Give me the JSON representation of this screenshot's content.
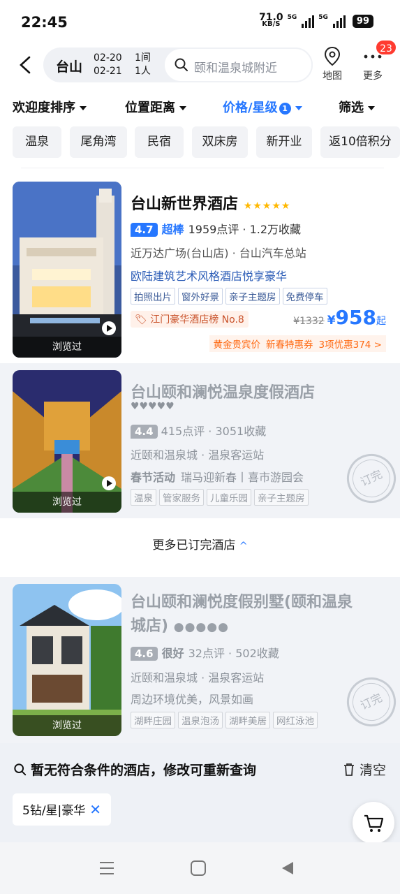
{
  "status": {
    "time": "22:45",
    "speed": "71.0",
    "speed_unit": "KB/S",
    "net1": "5G",
    "net2": "5G",
    "battery": "99"
  },
  "header": {
    "city": "台山",
    "date_in": "02-20",
    "date_out": "02-21",
    "rooms": "1间",
    "people": "1人",
    "search_placeholder": "颐和温泉城附近",
    "map_label": "地图",
    "more_label": "更多",
    "more_badge": "23"
  },
  "sort_bar": [
    {
      "label": "欢迎度排序",
      "active": false
    },
    {
      "label": "位置距离",
      "active": false
    },
    {
      "label": "价格/星级",
      "active": true,
      "count": "1"
    },
    {
      "label": "筛选",
      "active": false
    }
  ],
  "quick_filters": [
    "温泉",
    "尾角湾",
    "民宿",
    "双床房",
    "新开业",
    "返10倍积分"
  ],
  "hotels": [
    {
      "name": "台山新世界酒店",
      "stars": "★★★★★",
      "score": "4.7",
      "score_word": "超棒",
      "reviews": "1959点评 · 1.2万收藏",
      "location": "近万达广场(台山店) · 台山汽车总站",
      "feature": "欧陆建筑艺术风格酒店悦享豪华",
      "tags": [
        "拍照出片",
        "窗外好景",
        "亲子主题房",
        "免费停车"
      ],
      "rank": "江门豪华酒店榜 No.8",
      "old_price": "¥1332",
      "currency": "¥",
      "price": "958",
      "price_suffix": "起",
      "promos": [
        "黄金贵宾价",
        "新春特惠券",
        "3项优惠374 >"
      ],
      "viewed_label": "浏览过"
    },
    {
      "name": "台山颐和澜悦温泉度假酒店",
      "stars": "♥♥♥♥♥",
      "score": "4.4",
      "reviews": "415点评 · 3051收藏",
      "location": "近颐和温泉城 · 温泉客运站",
      "feature_prefix": "春节活动",
      "feature": "瑞马迎新春丨喜市游园会",
      "tags": [
        "温泉",
        "管家服务",
        "儿童乐园",
        "亲子主题房"
      ],
      "stamp": "订完",
      "viewed_label": "浏览过"
    },
    {
      "name_line1": "台山颐和澜悦度假别墅(颐和温泉",
      "name_line2": "城店)",
      "stars": "●●●●●",
      "score": "4.6",
      "score_word": "很好",
      "reviews": "32点评 · 502收藏",
      "location": "近颐和温泉城 · 温泉客运站",
      "feature": "周边环境优美，风景如画",
      "tags": [
        "湖畔庄园",
        "温泉泡汤",
        "湖畔美居",
        "网红泳池"
      ],
      "stamp": "订完",
      "viewed_label": "浏览过"
    }
  ],
  "more_booked": {
    "label": "更多已订完酒店",
    "chevron": "^"
  },
  "no_results": {
    "text": "暂无符合条件的酒店，修改可重新查询",
    "clear_label": "清空",
    "filter_chip": "5钻/星|豪华"
  }
}
